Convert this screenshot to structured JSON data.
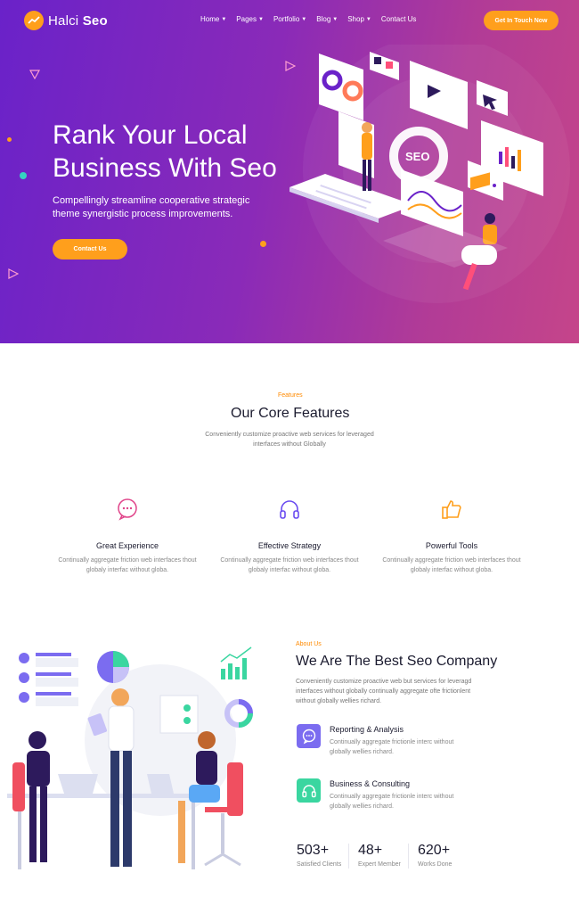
{
  "nav": {
    "logo_main": "Halci",
    "logo_bold": "Seo",
    "menu": [
      "Home",
      "Pages",
      "Portfolio",
      "Blog",
      "Shop",
      "Contact Us"
    ],
    "cta": "Get In Touch Now"
  },
  "hero": {
    "title": "Rank Your Local Business With Seo",
    "subtitle": "Compellingly streamline cooperative strategic theme synergistic process improvements.",
    "button": "Contact Us",
    "art_label": "SEO"
  },
  "features": {
    "eyebrow": "Features",
    "title": "Our Core Features",
    "description": "Conveniently customize proactive web services for leveraged interfaces without Globally",
    "items": [
      {
        "title": "Great Experience",
        "description": "Continually aggregate friction web interfaces thout globaly interfac without globa.",
        "icon": "chat-bubble-icon",
        "color": "#e0458a"
      },
      {
        "title": "Effective Strategy",
        "description": "Continually aggregate friction web interfaces thout globaly interfac without globa.",
        "icon": "headphones-icon",
        "color": "#6a4cf0"
      },
      {
        "title": "Powerful Tools",
        "description": "Continually aggregate friction web interfaces thout globaly interfac without globa.",
        "icon": "thumbs-up-icon",
        "color": "#ff9f1c"
      }
    ]
  },
  "about": {
    "eyebrow": "About Us",
    "title": "We Are The Best Seo Company",
    "description": "Conveniently customize proactive web but services for leveragd interfaces without globally continually aggregate ofte frictionlent without globally wellies richard.",
    "services": [
      {
        "title": "Reporting & Analysis",
        "description": "Continually aggregate frictionle interc without globally wellies richard.",
        "icon": "chat-bubble-icon",
        "color": "#7b6cf0"
      },
      {
        "title": "Business & Consulting",
        "description": "Continually aggregate frictionle interc without globally wellies richard.",
        "icon": "headphones-icon",
        "color": "#3ad6a0"
      }
    ],
    "stats": [
      {
        "value": "503+",
        "label": "Satisfied Clients"
      },
      {
        "value": "48+",
        "label": "Expert Member"
      },
      {
        "value": "620+",
        "label": "Works Done"
      }
    ]
  },
  "colors": {
    "accent": "#ff9f1c",
    "hero_start": "#6a22c9",
    "hero_end": "#c5458a"
  }
}
